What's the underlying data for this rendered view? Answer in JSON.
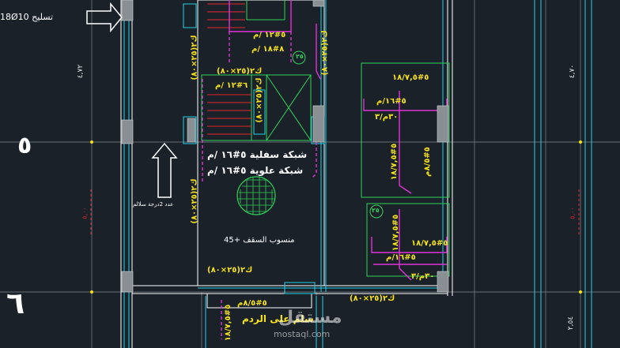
{
  "drawing": {
    "top_label": "18Ø10 تسليح",
    "arrow_note": "عدد 2درجة سلالم",
    "slab_mesh_bottom": "شبكة سفلية ٥#١٦ /م",
    "slab_mesh_top": "شبكة علوية ٥#١٦ /م",
    "level_label": "منسوب السقف +45",
    "stair_label": "سلم على الردم",
    "bar_8_18": "٨#١٨ /م",
    "bar_5_12": "٥#١٢ /م",
    "bar_6_12": "٦#١٢ /م",
    "bar_3": "٣/م",
    "bar_5_18_75": "٥#١٨/٧,٥",
    "bar_5_16_m": "٥#١٦/م",
    "bar_3_30": "٣٠م/٣",
    "bar_5_8_5": "٥#٨/٥م",
    "beam_k2": "ك٢(٢٥×٨٠)",
    "circle_25": "٢٥",
    "axis_5": "٥",
    "axis_6": "٦",
    "dim_left": "٤,٧٢",
    "dim_right": "٤,٧٠",
    "dim_bottom_right": "٢,٥٤",
    "red_dim": "٥,٠٠"
  },
  "colors": {
    "background": "#1b2129",
    "cyan": "#22d3e6",
    "green": "#2fd25a",
    "magenta": "#e032d8",
    "yellow": "#f5e21a",
    "red": "#e0262c",
    "grey": "#a3a8ad"
  },
  "watermark": {
    "brand_arabic": "مستقل",
    "brand_latin": "mostaql.com"
  }
}
